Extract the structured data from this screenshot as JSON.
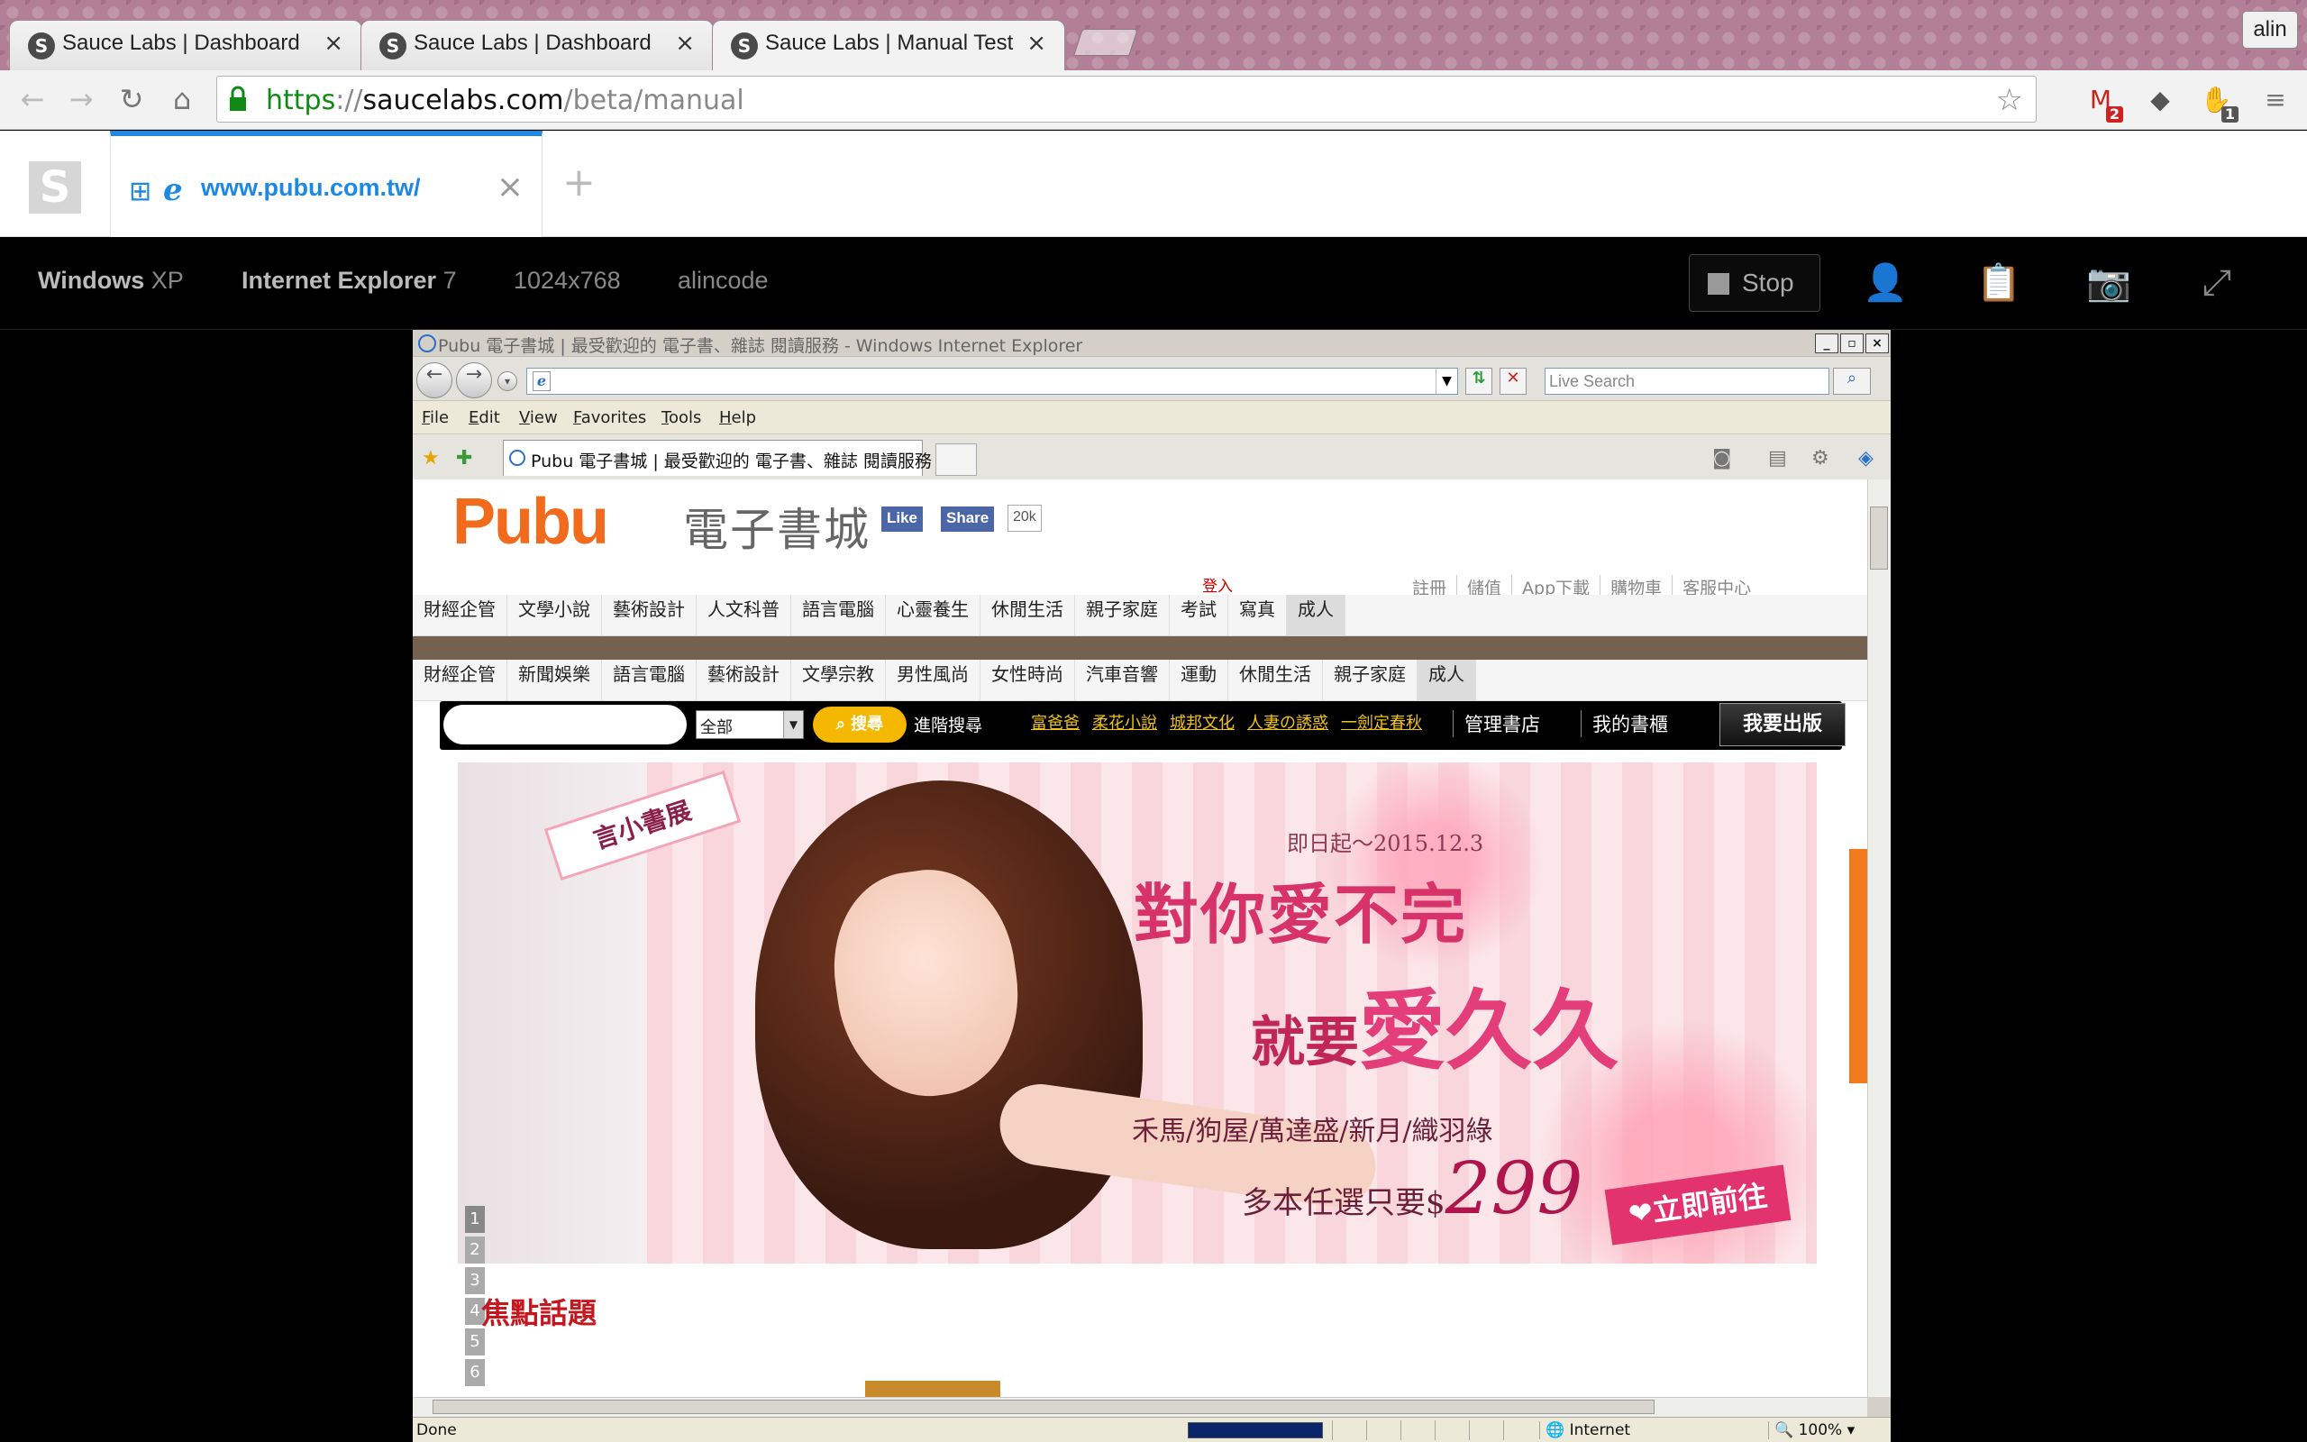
{
  "chrome": {
    "tabs": [
      {
        "title": "Sauce Labs | Dashboard"
      },
      {
        "title": "Sauce Labs | Dashboard"
      },
      {
        "title": "Sauce Labs | Manual Test"
      }
    ],
    "profile": "alin",
    "url_scheme": "https",
    "url_sep": "://",
    "url_host": "saucelabs.com",
    "url_path": "/beta/manual",
    "extensions": [
      {
        "name": "gmail-icon",
        "badge": "2"
      },
      {
        "name": "evernote-icon",
        "badge": ""
      },
      {
        "name": "adblock-icon",
        "badge": "1"
      }
    ]
  },
  "sauce": {
    "session_tab_label": "www.pubu.com.tw/",
    "add_label": "+",
    "os_name": "Windows",
    "os_version": "XP",
    "browser_name": "Internet Explorer",
    "browser_version": "7",
    "resolution": "1024x768",
    "user": "alincode",
    "stop_label": "Stop"
  },
  "ie": {
    "window_title": "Pubu 電子書城 | 最受歡迎的 電子書、雜誌 閱讀服務 - Windows Internet Explorer",
    "search_placeholder": "Live Search",
    "menu": [
      "File",
      "Edit",
      "View",
      "Favorites",
      "Tools",
      "Help"
    ],
    "tab_title": "Pubu 電子書城 | 最受歡迎的 電子書、雜誌 閱讀服務",
    "status_text": "Done",
    "zone": "Internet",
    "zoom": "100%"
  },
  "page": {
    "logo": "Pubu",
    "subtitle": "電子書城",
    "fb_like": "Like",
    "fb_share": "Share",
    "fb_count": "20k",
    "login": "登入",
    "top_links": [
      "註冊",
      "儲值",
      "App下載",
      "購物車",
      "客服中心"
    ],
    "categories_1": [
      "財經企管",
      "文學小說",
      "藝術設計",
      "人文科普",
      "語言電腦",
      "心靈養生",
      "休閒生活",
      "親子家庭",
      "考試",
      "寫真",
      "成人"
    ],
    "categories_2": [
      "財經企管",
      "新聞娛樂",
      "語言電腦",
      "藝術設計",
      "文學宗教",
      "男性風尚",
      "女性時尚",
      "汽車音響",
      "運動",
      "休閒生活",
      "親子家庭",
      "成人"
    ],
    "search_select": "全部",
    "search_button": "搜尋",
    "advanced_search": "進階搜尋",
    "hot_tags": [
      "富爸爸",
      "柔花小說",
      "城邦文化",
      "人妻の誘惑",
      "一劍定春秋"
    ],
    "manage_shelf": "管理書店",
    "my_shelf": "我的書櫃",
    "publish": "我要出版",
    "banner": {
      "tag": "言小書展",
      "date": "即日起～2015.12.3",
      "headline1": "對你愛不完",
      "headline2a": "就要",
      "headline2b": "愛久久",
      "authors": "禾馬/狗屋/萬達盛/新月/織羽綠",
      "price_prefix": "多本任選只要$",
      "price": "299",
      "cta": "❤立即前往"
    },
    "slide_numbers": [
      "1",
      "2",
      "3",
      "4",
      "5",
      "6"
    ],
    "focus_title": "焦點話題"
  }
}
